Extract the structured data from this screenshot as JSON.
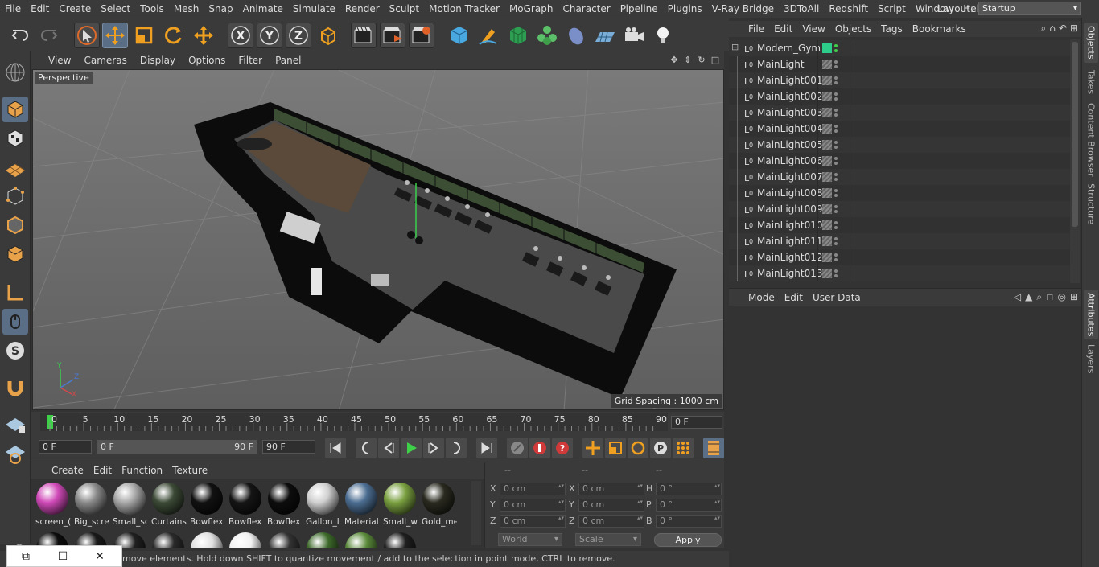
{
  "menubar": {
    "items": [
      "File",
      "Edit",
      "Create",
      "Select",
      "Tools",
      "Mesh",
      "Snap",
      "Animate",
      "Simulate",
      "Render",
      "Sculpt",
      "Motion Tracker",
      "MoGraph",
      "Character",
      "Pipeline",
      "Plugins",
      "V-Ray Bridge",
      "3DToAll",
      "Redshift",
      "Script",
      "Window",
      "Help"
    ],
    "layout_label": "Layout:",
    "layout_value": "Startup"
  },
  "toolbar": {
    "icons": [
      "undo-icon",
      "redo-icon",
      "select-arrow-icon",
      "move-icon",
      "scale-icon",
      "rotate-icon",
      "live-selection-icon",
      "x-axis-icon",
      "y-axis-icon",
      "z-axis-icon",
      "coordinate-system-icon",
      "render-view-icon",
      "render-picture-viewer-icon",
      "render-settings-icon",
      "cube-icon",
      "pen-icon",
      "subdivision-icon",
      "cloner-icon",
      "deformer-icon",
      "floor-icon",
      "camera-icon",
      "light-icon"
    ],
    "axis_labels": [
      "X",
      "Y",
      "Z"
    ]
  },
  "viewport": {
    "menu": [
      "View",
      "Cameras",
      "Display",
      "Options",
      "Filter",
      "Panel"
    ],
    "label": "Perspective",
    "grid_spacing": "Grid Spacing : 1000 cm"
  },
  "timeline": {
    "ticks": [
      "0",
      "5",
      "10",
      "15",
      "20",
      "25",
      "30",
      "35",
      "40",
      "45",
      "50",
      "55",
      "60",
      "65",
      "70",
      "75",
      "80",
      "85",
      "90"
    ],
    "current_frame": "0 F",
    "start_field": "0 F",
    "range_start": "0 F",
    "range_end": "90 F",
    "end_field": "90 F"
  },
  "materials": {
    "menu": [
      "Create",
      "Edit",
      "Function",
      "Texture"
    ],
    "items": [
      {
        "label": "screen_(",
        "color": "#d04ab8"
      },
      {
        "label": "Big_scre",
        "color": "#8a8a8a"
      },
      {
        "label": "Small_sc",
        "color": "#a9a9a9"
      },
      {
        "label": "Curtains",
        "color": "#3c4a36"
      },
      {
        "label": "Bowflex",
        "color": "#111111"
      },
      {
        "label": "Bowflex",
        "color": "#151515"
      },
      {
        "label": "Bowflex",
        "color": "#0d0d0d"
      },
      {
        "label": "Gallon_l",
        "color": "#cfcfcf"
      },
      {
        "label": "Material",
        "color": "#4c6e92"
      },
      {
        "label": "Small_w",
        "color": "#7aa040"
      },
      {
        "label": "Gold_me",
        "color": "#2a2a20"
      }
    ],
    "row2_colors": [
      "#0c0c0c",
      "#1a1a1a",
      "#202020",
      "#2a2a2a",
      "#e0e0e0",
      "#f2f2f2",
      "#333333",
      "#3d6a2a",
      "#5a8a3a",
      "#1f1f1f"
    ]
  },
  "coordinates": {
    "headers": [
      "--",
      "--",
      "--"
    ],
    "rows": [
      {
        "axis": "X",
        "pos": "0 cm",
        "size_axis": "X",
        "size": "0 cm",
        "rot_axis": "H",
        "rot": "0 °"
      },
      {
        "axis": "Y",
        "pos": "0 cm",
        "size_axis": "Y",
        "size": "0 cm",
        "rot_axis": "P",
        "rot": "0 °"
      },
      {
        "axis": "Z",
        "pos": "0 cm",
        "size_axis": "Z",
        "size": "0 cm",
        "rot_axis": "B",
        "rot": "0 °"
      }
    ],
    "world_select": "World",
    "scale_select": "Scale",
    "apply": "Apply"
  },
  "statusbar": {
    "text": "move elements. Hold down SHIFT to quantize movement / add to the selection in point mode, CTRL to remove."
  },
  "objects": {
    "menu": [
      "File",
      "Edit",
      "View",
      "Objects",
      "Tags",
      "Bookmarks"
    ],
    "items": [
      "Modern_Gym",
      "MainLight",
      "MainLight001",
      "MainLight002",
      "MainLight003",
      "MainLight004",
      "MainLight005",
      "MainLight006",
      "MainLight007",
      "MainLight008",
      "MainLight009",
      "MainLight010",
      "MainLight011",
      "MainLight012",
      "MainLight013"
    ]
  },
  "attributes": {
    "menu": [
      "Mode",
      "Edit",
      "User Data"
    ]
  },
  "side_tabs": [
    "Objects",
    "Takes",
    "Content Browser",
    "Structure"
  ],
  "side_tabs_lower": [
    "Attributes",
    "Layers"
  ],
  "colors": {
    "accent": "#5a6e86",
    "play_green": "#3fd04a",
    "record_red": "#d03a3a",
    "layer_green": "#2ecc8a"
  }
}
